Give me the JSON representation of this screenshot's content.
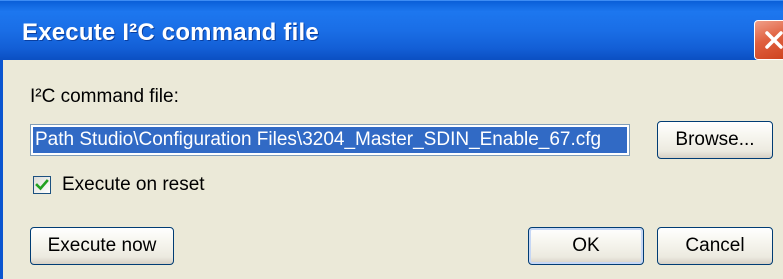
{
  "window": {
    "title": "Execute I²C command file",
    "close_icon": "close-icon"
  },
  "form": {
    "file_label": "I²C command file:",
    "file_path_value": "Path Studio\\Configuration Files\\3204_Master_SDIN_Enable_67.cfg",
    "browse_label": "Browse...",
    "execute_on_reset_label": "Execute on reset",
    "execute_on_reset_checked": true
  },
  "buttons": {
    "execute_now": "Execute now",
    "ok": "OK",
    "cancel": "Cancel"
  },
  "colors": {
    "titlebar": "#1a6ee6",
    "selection": "#316ac5",
    "close": "#e0603f",
    "dialog_bg": "#ebe9d8",
    "checkmark": "#21a121"
  }
}
